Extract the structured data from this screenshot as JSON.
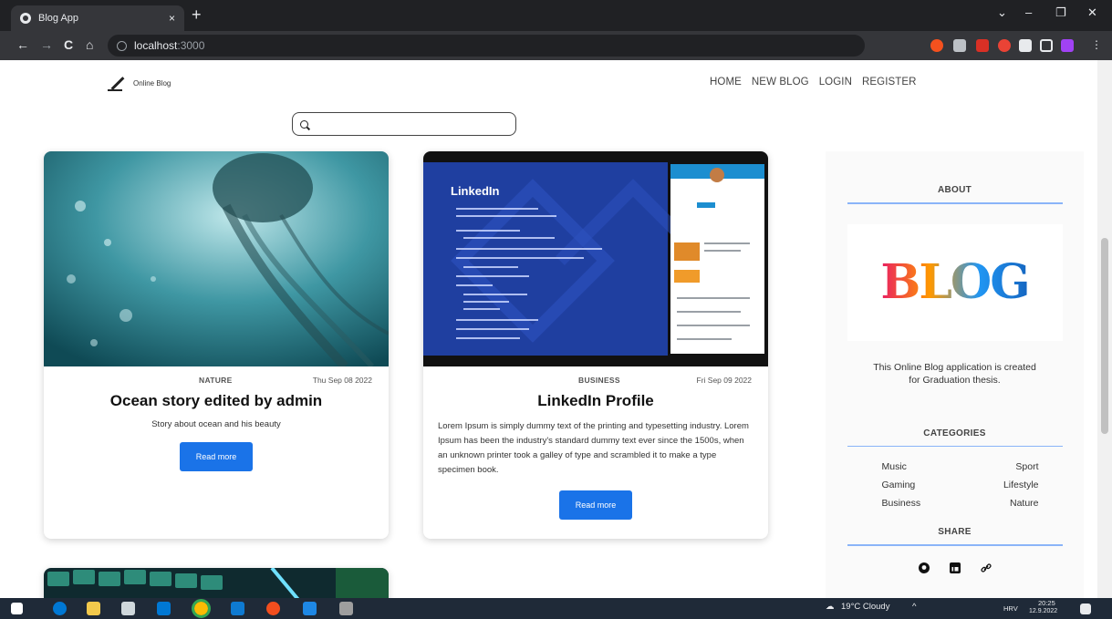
{
  "browser": {
    "tab_title": "Blog App",
    "tab_close": "×",
    "new_tab": "+",
    "url_host": "localhost",
    "url_port": ":3000",
    "back": "←",
    "forward": "→",
    "reload": "C",
    "home": "⌂",
    "minimize": "–",
    "maximize": "❐",
    "close": "✕",
    "menu_chevron": "⌄"
  },
  "site": {
    "logo_text": "Online Blog",
    "nav": [
      "HOME",
      "NEW BLOG",
      "LOGIN",
      "REGISTER"
    ],
    "search": {
      "value": "",
      "placeholder": ""
    }
  },
  "posts": [
    {
      "category": "NATURE",
      "date": "Thu Sep 08 2022",
      "title": "Ocean story edited by admin",
      "description": "Story about ocean and his beauty",
      "button": "Read more",
      "image": "jellyfish-photo"
    },
    {
      "category": "BUSINESS",
      "date": "Fri Sep 09 2022",
      "title": "LinkedIn Profile",
      "description": "Lorem Ipsum is simply dummy text of the printing and typesetting industry. Lorem Ipsum has been the industry's standard dummy text ever since the 1500s, when an unknown printer took a galley of type and scrambled it to make a type specimen book.",
      "button": "Read more",
      "image": "linkedin-slide",
      "image_heading": "LinkedIn"
    }
  ],
  "sidebar": {
    "about_title": "ABOUT",
    "about_image_text": "BLOG",
    "about_text": "This Online Blog application is created for Graduation thesis.",
    "categories_title": "CATEGORIES",
    "categories": [
      "Music",
      "Sport",
      "Gaming",
      "Lifestyle",
      "Business",
      "Nature"
    ],
    "share_title": "SHARE",
    "share_icons": [
      "github-icon",
      "linkedin-icon",
      "link-icon"
    ]
  },
  "taskbar": {
    "weather": "19°C Cloudy",
    "time": "20:25",
    "date": "12.9.2022",
    "lang": "HRV"
  },
  "colors": {
    "accent": "#1a73e8",
    "divider": "#8ab4f8",
    "chrome_dark": "#202124",
    "chrome_toolbar": "#35363a"
  }
}
